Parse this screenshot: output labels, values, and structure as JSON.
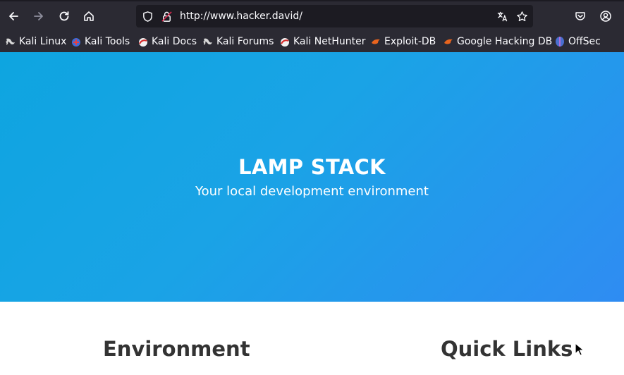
{
  "browser": {
    "url": "http://www.hacker.david/",
    "bookmarks": [
      {
        "label": "Kali Linux",
        "icon": "kali-dragon-icon"
      },
      {
        "label": "Kali Tools",
        "icon": "kali-tools-icon"
      },
      {
        "label": "Kali Docs",
        "icon": "kali-docs-icon"
      },
      {
        "label": "Kali Forums",
        "icon": "kali-dragon-icon"
      },
      {
        "label": "Kali NetHunter",
        "icon": "kali-docs-icon"
      },
      {
        "label": "Exploit-DB",
        "icon": "exploit-db-icon"
      },
      {
        "label": "Google Hacking DB",
        "icon": "exploit-db-icon"
      },
      {
        "label": "OffSec",
        "icon": "offsec-icon"
      }
    ]
  },
  "hero": {
    "title": "LAMP STACK",
    "subtitle": "Your local development environment"
  },
  "sections": {
    "environment": "Environment",
    "quick_links": "Quick Links"
  },
  "colors": {
    "hero_start": "#0ea5e0",
    "hero_end": "#2f8cf2",
    "chrome_bg": "#2b2a33",
    "heading_text": "#333333"
  }
}
